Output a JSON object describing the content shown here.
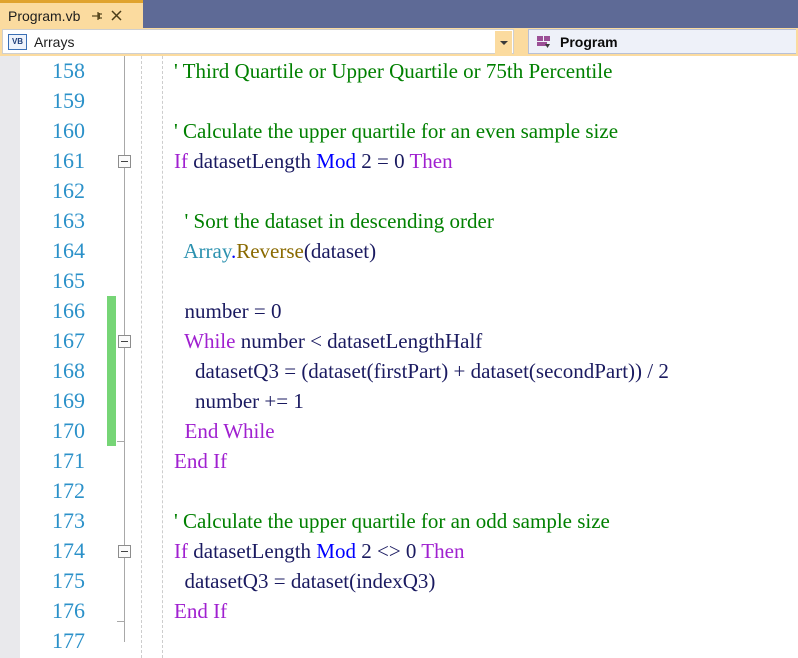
{
  "window": {
    "tab": {
      "title": "Program.vb",
      "pin_icon": "pin-icon",
      "close_icon": "close-icon"
    }
  },
  "navbar": {
    "left_dropdown": {
      "icon": "vb-file-icon",
      "icon_label": "VB",
      "value": "Arrays",
      "arrow_icon": "chevron-down-icon"
    },
    "right_dropdown": {
      "icon": "method-member-icon",
      "value": "Program"
    }
  },
  "editor": {
    "first_line_number": 158,
    "colors": {
      "comment": "#008000",
      "keyword": "#a020d0",
      "operator_keyword": "#0000ff",
      "type": "#2b91af",
      "method": "#8a6a00",
      "plain": "#1a1a60",
      "line_number": "#2b91c9",
      "change_bar": "#76d576",
      "tab_background": "#fbdb9f",
      "tabstrip_background": "#5e6a96"
    },
    "lines": [
      {
        "number": "158",
        "fold": false,
        "changed": false,
        "tokens": [
          {
            "text": "' Third Quartile or Upper Quartile or 75th Percentile",
            "cls": "t-comment"
          }
        ]
      },
      {
        "number": "159",
        "fold": false,
        "changed": false,
        "tokens": []
      },
      {
        "number": "160",
        "fold": false,
        "changed": false,
        "tokens": [
          {
            "text": "' Calculate the upper quartile for an even sample size",
            "cls": "t-comment"
          }
        ]
      },
      {
        "number": "161",
        "fold": true,
        "changed": false,
        "tokens": [
          {
            "text": "If ",
            "cls": "t-keyword"
          },
          {
            "text": "datasetLength ",
            "cls": "t-plain"
          },
          {
            "text": "Mod ",
            "cls": "t-operator-kw"
          },
          {
            "text": "2 = 0 ",
            "cls": "t-plain"
          },
          {
            "text": "Then",
            "cls": "t-keyword"
          }
        ]
      },
      {
        "number": "162",
        "fold": false,
        "changed": false,
        "tokens": []
      },
      {
        "number": "163",
        "fold": false,
        "changed": false,
        "tokens": [
          {
            "text": "  ' Sort the dataset in descending order",
            "cls": "t-comment"
          }
        ]
      },
      {
        "number": "164",
        "fold": false,
        "changed": false,
        "tokens": [
          {
            "text": "  ",
            "cls": "t-plain"
          },
          {
            "text": "Array",
            "cls": "t-type"
          },
          {
            "text": ".",
            "cls": "t-operator-kw"
          },
          {
            "text": "Reverse",
            "cls": "t-method"
          },
          {
            "text": "(dataset)",
            "cls": "t-plain"
          }
        ]
      },
      {
        "number": "165",
        "fold": false,
        "changed": false,
        "tokens": []
      },
      {
        "number": "166",
        "fold": false,
        "changed": true,
        "tokens": [
          {
            "text": "  number = 0",
            "cls": "t-plain"
          }
        ]
      },
      {
        "number": "167",
        "fold": true,
        "changed": true,
        "tokens": [
          {
            "text": "  ",
            "cls": "t-plain"
          },
          {
            "text": "While ",
            "cls": "t-keyword"
          },
          {
            "text": "number < datasetLengthHalf",
            "cls": "t-plain"
          }
        ]
      },
      {
        "number": "168",
        "fold": false,
        "changed": true,
        "tokens": [
          {
            "text": "    datasetQ3 = (dataset(firstPart) + dataset(secondPart)) / 2",
            "cls": "t-plain"
          }
        ]
      },
      {
        "number": "169",
        "fold": false,
        "changed": true,
        "tokens": [
          {
            "text": "    number += 1",
            "cls": "t-plain"
          }
        ]
      },
      {
        "number": "170",
        "fold": false,
        "changed": true,
        "tokens": [
          {
            "text": "  ",
            "cls": "t-plain"
          },
          {
            "text": "End While",
            "cls": "t-keyword"
          }
        ]
      },
      {
        "number": "171",
        "fold": false,
        "changed": false,
        "tokens": [
          {
            "text": "End If",
            "cls": "t-keyword"
          }
        ]
      },
      {
        "number": "172",
        "fold": false,
        "changed": false,
        "tokens": []
      },
      {
        "number": "173",
        "fold": false,
        "changed": false,
        "tokens": [
          {
            "text": "' Calculate the upper quartile for an odd sample size",
            "cls": "t-comment"
          }
        ]
      },
      {
        "number": "174",
        "fold": true,
        "changed": false,
        "tokens": [
          {
            "text": "If ",
            "cls": "t-keyword"
          },
          {
            "text": "datasetLength ",
            "cls": "t-plain"
          },
          {
            "text": "Mod ",
            "cls": "t-operator-kw"
          },
          {
            "text": "2 <> 0 ",
            "cls": "t-plain"
          },
          {
            "text": "Then",
            "cls": "t-keyword"
          }
        ]
      },
      {
        "number": "175",
        "fold": false,
        "changed": false,
        "tokens": [
          {
            "text": "  datasetQ3 = dataset(indexQ3)",
            "cls": "t-plain"
          }
        ]
      },
      {
        "number": "176",
        "fold": false,
        "changed": false,
        "tokens": [
          {
            "text": "End If",
            "cls": "t-keyword"
          }
        ]
      },
      {
        "number": "177",
        "fold": false,
        "changed": false,
        "tokens": []
      }
    ]
  }
}
